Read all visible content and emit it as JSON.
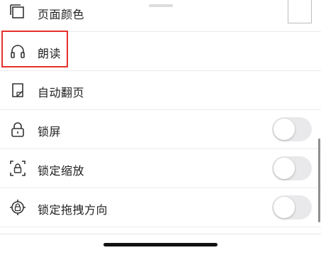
{
  "menu": {
    "items": [
      {
        "label": "页面颜色",
        "icon": "page-color-icon",
        "control": "swatch"
      },
      {
        "label": "朗读",
        "icon": "headphones-icon",
        "control": "none",
        "highlighted": true
      },
      {
        "label": "自动翻页",
        "icon": "auto-page-turn-icon",
        "control": "none"
      },
      {
        "label": "锁屏",
        "icon": "lock-icon",
        "control": "toggle",
        "on": false
      },
      {
        "label": "锁定缩放",
        "icon": "lock-zoom-icon",
        "control": "toggle",
        "on": false
      },
      {
        "label": "锁定拖拽方向",
        "icon": "lock-drag-direction-icon",
        "control": "toggle",
        "on": false
      }
    ]
  },
  "colors": {
    "highlight": "#e5312b",
    "toggle_off": "#e9e9eb",
    "text": "#222222"
  }
}
